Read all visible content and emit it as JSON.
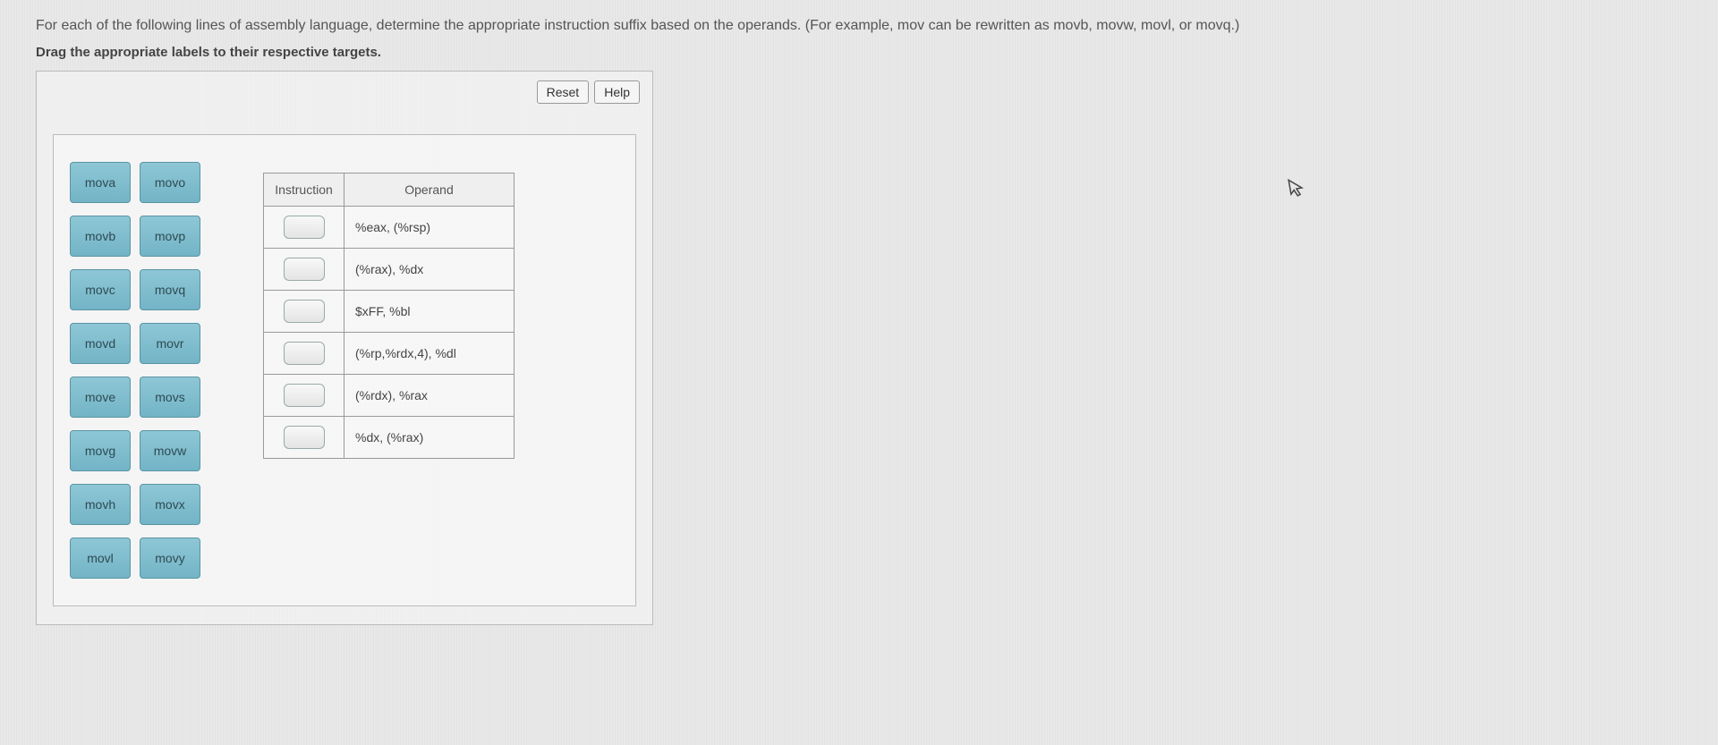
{
  "intro": "For each of the following lines of assembly language, determine the appropriate instruction suffix based on the operands. (For example, mov can be rewritten as movb, movw, movl, or movq.)",
  "instructions": "Drag the appropriate labels to their respective targets.",
  "toolbar": {
    "reset": "Reset",
    "help": "Help"
  },
  "labels": [
    "mova",
    "movo",
    "movb",
    "movp",
    "movc",
    "movq",
    "movd",
    "movr",
    "move",
    "movs",
    "movg",
    "movw",
    "movh",
    "movx",
    "movl",
    "movy"
  ],
  "table": {
    "headers": {
      "instruction": "Instruction",
      "operand": "Operand"
    },
    "rows": [
      {
        "operand": "%eax, (%rsp)"
      },
      {
        "operand": "(%rax), %dx"
      },
      {
        "operand": "$xFF, %bl"
      },
      {
        "operand": "(%rp,%rdx,4), %dl"
      },
      {
        "operand": "(%rdx), %rax"
      },
      {
        "operand": "%dx, (%rax)"
      }
    ]
  }
}
